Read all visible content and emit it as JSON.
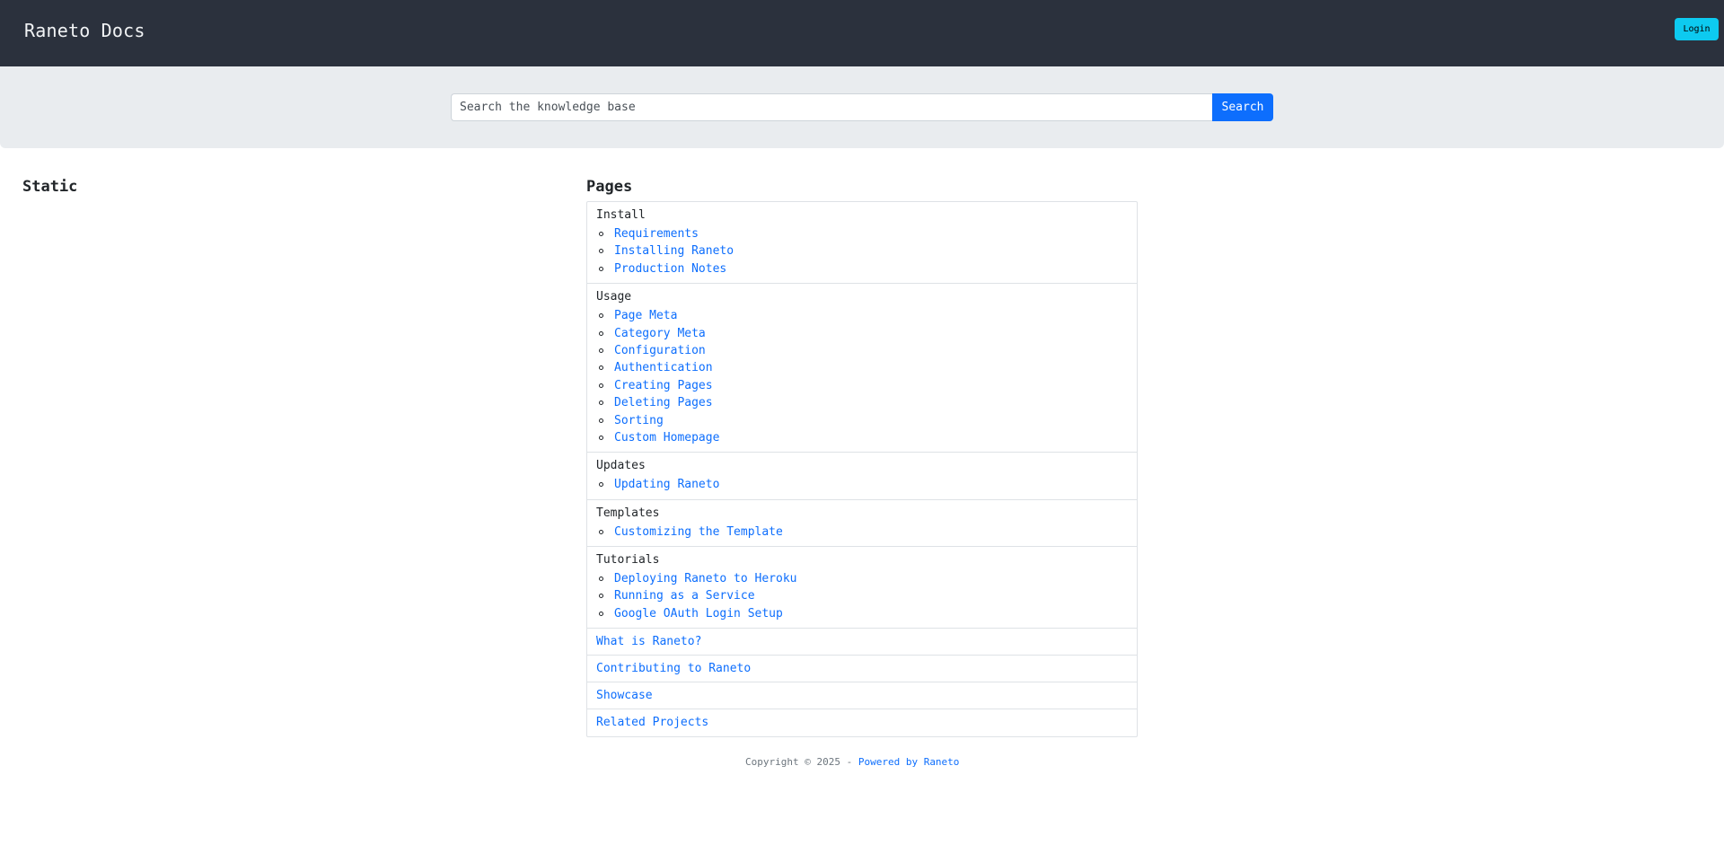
{
  "header": {
    "brand": "Raneto Docs",
    "login_label": "Login"
  },
  "search": {
    "placeholder": "Search the knowledge base",
    "button_label": "Search"
  },
  "static_section": {
    "heading": "Static"
  },
  "pages_section": {
    "heading": "Pages",
    "groups": [
      {
        "title": "Install",
        "items": [
          "Requirements",
          "Installing Raneto",
          "Production Notes"
        ]
      },
      {
        "title": "Usage",
        "items": [
          "Page Meta",
          "Category Meta",
          "Configuration",
          "Authentication",
          "Creating Pages",
          "Deleting Pages",
          "Sorting",
          "Custom Homepage"
        ]
      },
      {
        "title": "Updates",
        "items": [
          "Updating Raneto"
        ]
      },
      {
        "title": "Templates",
        "items": [
          "Customizing the Template"
        ]
      },
      {
        "title": "Tutorials",
        "items": [
          "Deploying Raneto to Heroku",
          "Running as a Service",
          "Google OAuth Login Setup"
        ]
      }
    ],
    "singles": [
      "What is Raneto?",
      "Contributing to Raneto",
      "Showcase",
      "Related Projects"
    ]
  },
  "footer": {
    "copyright": "Copyright © 2025 - ",
    "powered_by": "Powered by Raneto"
  },
  "colors": {
    "navbar_bg": "#2b313d",
    "search_band_bg": "#e9ecef",
    "link": "#0d6efd",
    "login_button": "#0dcaf0",
    "search_button": "#0d6efd"
  }
}
